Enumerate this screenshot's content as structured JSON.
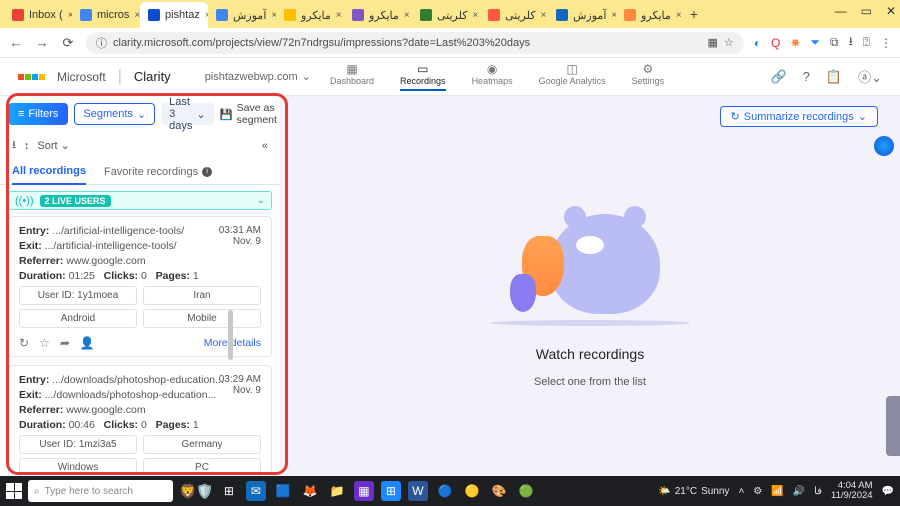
{
  "browser": {
    "tabs": [
      {
        "label": "Inbox (",
        "favicon": "#ea4335"
      },
      {
        "label": "micros",
        "favicon": "#4285f4"
      },
      {
        "label": "pishtaz",
        "favicon": "#0a4bd1",
        "active": true
      },
      {
        "label": "آموزش",
        "favicon": "#4285f4"
      },
      {
        "label": "مایکرو",
        "favicon": "#ffbf00"
      },
      {
        "label": "مایکرو",
        "favicon": "#7e57c2"
      },
      {
        "label": "کلریتی",
        "favicon": "#2e7d32"
      },
      {
        "label": "کلریتی",
        "favicon": "#ff5940"
      },
      {
        "label": "آموزش",
        "favicon": "#1565c0"
      },
      {
        "label": "مایکرو",
        "favicon": "#ff8a3d"
      }
    ],
    "url": "clarity.microsoft.com/projects/view/72n7ndrgsu/impressions?date=Last%203%20days",
    "window_controls": {
      "min": "—",
      "max": "▭",
      "close": "✕"
    }
  },
  "header": {
    "brand_company": "Microsoft",
    "brand_product": "Clarity",
    "workspace": "pishtazwebwp.com",
    "nav": [
      {
        "label": "Dashboard",
        "icon": "▦"
      },
      {
        "label": "Recordings",
        "icon": "▭",
        "active": true
      },
      {
        "label": "Heatmaps",
        "icon": "◉"
      },
      {
        "label": "Google Analytics",
        "icon": "◫"
      },
      {
        "label": "Settings",
        "icon": "⚙"
      }
    ]
  },
  "toolbar": {
    "filters": "Filters",
    "segments": "Segments",
    "daterange": "Last 3 days",
    "save_segment": "Save as segment",
    "summarize": "Summarize recordings"
  },
  "sort": {
    "label": "Sort"
  },
  "rec_tabs": {
    "all": "All recordings",
    "fav": "Favorite recordings"
  },
  "live": {
    "badge": "2 LIVE USERS"
  },
  "labels": {
    "entry": "Entry:",
    "exit": "Exit:",
    "referrer": "Referrer:",
    "duration": "Duration:",
    "clicks": "Clicks:",
    "pages": "Pages:",
    "user_id": "User ID:",
    "more": "More details"
  },
  "cards": [
    {
      "time": "03:31 AM",
      "date": "Nov. 9",
      "entry": ".../artificial-intelligence-tools/",
      "exit": ".../artificial-intelligence-tools/",
      "referrer": "www.google.com",
      "duration": "01:25",
      "clicks": "0",
      "pages": "1",
      "user_id": "1y1moea",
      "country": "Iran",
      "os": "Android",
      "device": "Mobile"
    },
    {
      "time": "03:29 AM",
      "date": "Nov. 9",
      "entry": ".../downloads/photoshop-education...",
      "exit": ".../downloads/photoshop-education...",
      "referrer": "www.google.com",
      "duration": "00:46",
      "clicks": "0",
      "pages": "1",
      "user_id": "1mzi3a5",
      "country": "Germany",
      "os": "Windows",
      "device": "PC"
    }
  ],
  "main": {
    "title": "Watch recordings",
    "subtitle": "Select one from the list"
  },
  "taskbar": {
    "search_placeholder": "Type here to search",
    "weather_temp": "21°C",
    "weather_label": "Sunny",
    "lang": "فا",
    "time": "4:04 AM",
    "date": "11/9/2024"
  }
}
